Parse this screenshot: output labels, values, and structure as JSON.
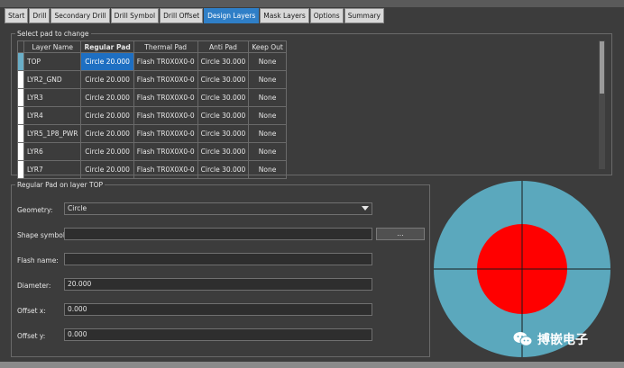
{
  "tabs": [
    {
      "label": "Start"
    },
    {
      "label": "Drill"
    },
    {
      "label": "Secondary Drill"
    },
    {
      "label": "Drill Symbol"
    },
    {
      "label": "Drill Offset"
    },
    {
      "label": "Design Layers",
      "active": true
    },
    {
      "label": "Mask Layers"
    },
    {
      "label": "Options"
    },
    {
      "label": "Summary"
    }
  ],
  "pad_group": {
    "title": "Select pad to change",
    "columns": [
      "",
      "Layer Name",
      "Regular Pad",
      "Thermal Pad",
      "Anti Pad",
      "Keep Out"
    ],
    "rows": [
      {
        "layer": "TOP",
        "regular": "Circle 20.000",
        "thermal": "Flash TR0X0X0-0",
        "anti": "Circle 30.000",
        "keepout": "None",
        "selected": true
      },
      {
        "layer": "LYR2_GND",
        "regular": "Circle 20.000",
        "thermal": "Flash TR0X0X0-0",
        "anti": "Circle 30.000",
        "keepout": "None"
      },
      {
        "layer": "LYR3",
        "regular": "Circle 20.000",
        "thermal": "Flash TR0X0X0-0",
        "anti": "Circle 30.000",
        "keepout": "None"
      },
      {
        "layer": "LYR4",
        "regular": "Circle 20.000",
        "thermal": "Flash TR0X0X0-0",
        "anti": "Circle 30.000",
        "keepout": "None"
      },
      {
        "layer": "LYR5_1P8_PWR",
        "regular": "Circle 20.000",
        "thermal": "Flash TR0X0X0-0",
        "anti": "Circle 30.000",
        "keepout": "None"
      },
      {
        "layer": "LYR6",
        "regular": "Circle 20.000",
        "thermal": "Flash TR0X0X0-0",
        "anti": "Circle 30.000",
        "keepout": "None"
      },
      {
        "layer": "LYR7",
        "regular": "Circle 20.000",
        "thermal": "Flash TR0X0X0-0",
        "anti": "Circle 30.000",
        "keepout": "None"
      }
    ]
  },
  "regular_group": {
    "title": "Regular Pad on layer TOP",
    "geometry_label": "Geometry:",
    "geometry_value": "Circle",
    "shape_symbol_label": "Shape symbol:",
    "shape_symbol_value": "",
    "browse_label": "...",
    "flash_name_label": "Flash name:",
    "flash_name_value": "",
    "diameter_label": "Diameter:",
    "diameter_value": "20.000",
    "offset_x_label": "Offset x:",
    "offset_x_value": "0.000",
    "offset_y_label": "Offset y:",
    "offset_y_value": "0.000"
  },
  "preview": {
    "anti_pad_color": "#5ba8bd",
    "regular_pad_color": "#ff0000",
    "crosshair_color": "#1a1a1a"
  },
  "watermark": {
    "text": "搏嵌电子"
  },
  "colors": {
    "accent": "#2f7fc7",
    "selection": "#1e6fc2"
  }
}
